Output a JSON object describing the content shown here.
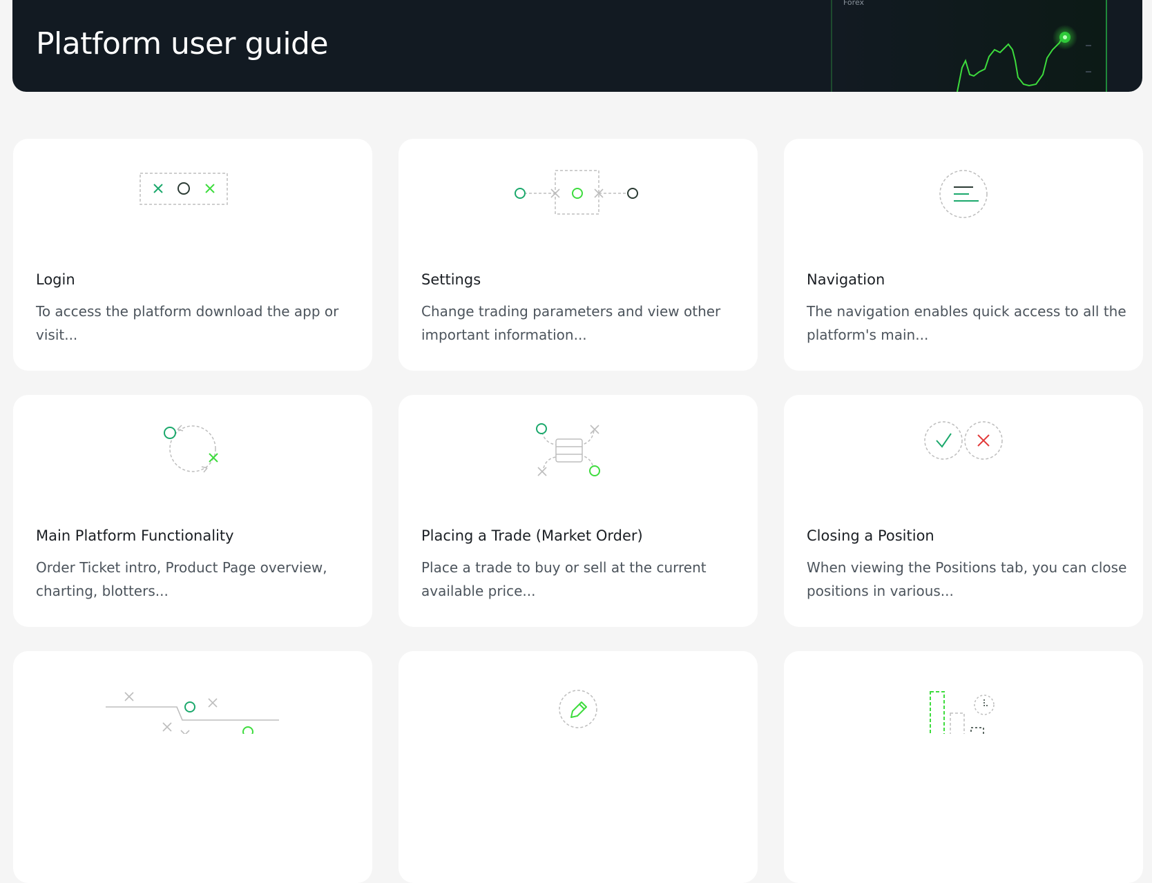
{
  "page": {
    "title": "Platform user guide",
    "hero_tag": "Forex"
  },
  "colors": {
    "hero_bg": "#121a22",
    "accent_green": "#3ddc3d",
    "accent_teal": "#1aa86b",
    "error_red": "#e23a3a",
    "page_bg": "#f5f5f5"
  },
  "cards": [
    {
      "title": "Login",
      "description": "To access the platform download the app or visit...",
      "icon": "login-icon"
    },
    {
      "title": "Settings",
      "description": "Change trading parameters and view other important information...",
      "icon": "settings-icon"
    },
    {
      "title": "Navigation",
      "description": "The navigation enables quick access to all the platform's main...",
      "icon": "navigation-icon"
    },
    {
      "title": "Main Platform Functionality",
      "description": "Order Ticket intro, Product Page overview, charting, blotters...",
      "icon": "functionality-icon"
    },
    {
      "title": "Placing a Trade (Market Order)",
      "description": "Place a trade to buy or sell at the current available price...",
      "icon": "trade-icon"
    },
    {
      "title": "Closing a Position",
      "description": "When viewing the Positions tab, you can close positions in various...",
      "icon": "close-position-icon"
    },
    {
      "title": "",
      "description": "",
      "icon": "order-flow-icon"
    },
    {
      "title": "",
      "description": "",
      "icon": "edit-pencil-icon"
    },
    {
      "title": "",
      "description": "",
      "icon": "chart-bars-icon"
    }
  ]
}
